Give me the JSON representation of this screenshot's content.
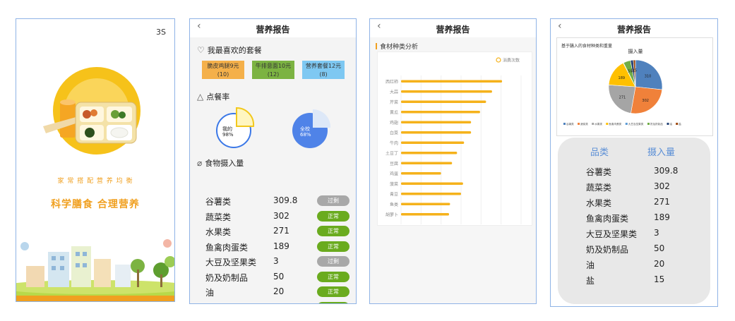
{
  "splash": {
    "countdown": "3S",
    "slogan_small": "家 常 搭 配 营 养 均 衡",
    "slogan_main": "科学膳食  合理营养"
  },
  "report": {
    "title": "营养报告",
    "favorites_heading": "我最喜欢的套餐",
    "combos": [
      {
        "name": "脆皮鸡腿9元",
        "count": "(10)",
        "color": "#f4b04a"
      },
      {
        "name": "牛排意面10元",
        "count": "(12)",
        "color": "#7cb342"
      },
      {
        "name": "营养套餐12元",
        "count": "(8)",
        "color": "#7ec8f2"
      }
    ],
    "order_rate_heading": "点餐率",
    "my_rate": {
      "label": "我的",
      "value": "98%",
      "fraction": 0.25
    },
    "school_rate": {
      "label": "全校",
      "value": "68%",
      "fraction": 0.75
    },
    "intake_heading": "食物摄入量",
    "intake": [
      {
        "name": "谷薯类",
        "value": "309.8",
        "status": "过剩",
        "color": "#a8a8a8"
      },
      {
        "name": "蔬菜类",
        "value": "302",
        "status": "正常",
        "color": "#6aab1e"
      },
      {
        "name": "水果类",
        "value": "271",
        "status": "正常",
        "color": "#6aab1e"
      },
      {
        "name": "鱼禽肉蛋类",
        "value": "189",
        "status": "正常",
        "color": "#6aab1e"
      },
      {
        "name": "大豆及坚果类",
        "value": "3",
        "status": "过剩",
        "color": "#a8a8a8"
      },
      {
        "name": "奶及奶制品",
        "value": "50",
        "status": "正常",
        "color": "#6aab1e"
      },
      {
        "name": "油",
        "value": "20",
        "status": "正常",
        "color": "#6aab1e"
      },
      {
        "name": "盐",
        "value": "15",
        "status": "正常",
        "color": "#6aab1e"
      }
    ]
  },
  "ingredient_page": {
    "title": "营养报告",
    "heading": "食材种类分析",
    "legend": "消费次数"
  },
  "pie_page": {
    "title": "营养报告",
    "chart_heading": "基于膳入的食材种类和重量",
    "col_category": "品类",
    "col_intake": "摄入量"
  },
  "chart_data": [
    {
      "type": "bar",
      "title": "食材种类分析",
      "orientation": "horizontal",
      "categories": [
        "西红柿",
        "大蒜",
        "芹菜",
        "黄瓜",
        "鸡翅",
        "白菜",
        "牛肉",
        "土豆丁",
        "豆腐",
        "鸡蛋",
        "菠菜",
        "青豆",
        "鱼类",
        "胡萝卜"
      ],
      "series": [
        {
          "name": "消费次数",
          "values": [
            1010,
            910,
            850,
            790,
            700,
            700,
            630,
            560,
            510,
            400,
            620,
            600,
            490,
            480
          ]
        }
      ],
      "xlim": [
        0,
        1200
      ],
      "ticks": [
        "0",
        "200",
        "400",
        "600",
        "800",
        "1000",
        "1200"
      ],
      "color": "#f5b21b",
      "legend": "top-right"
    },
    {
      "type": "pie",
      "title": "摄入量",
      "categories": [
        "谷薯类",
        "蔬菜类",
        "水果类",
        "鱼禽肉蛋类",
        "大豆及坚果类",
        "奶及奶制品",
        "油",
        "盐"
      ],
      "values": [
        309.8,
        302,
        271,
        189,
        3,
        50,
        20,
        15
      ],
      "colors": [
        "#4f81bd",
        "#f0813a",
        "#a5a5a5",
        "#ffc000",
        "#5b9bd5",
        "#70ad47",
        "#264478",
        "#9e480e"
      ],
      "labels": [
        "310",
        "302",
        "271",
        "189",
        "",
        "50",
        "20",
        "15"
      ]
    }
  ]
}
